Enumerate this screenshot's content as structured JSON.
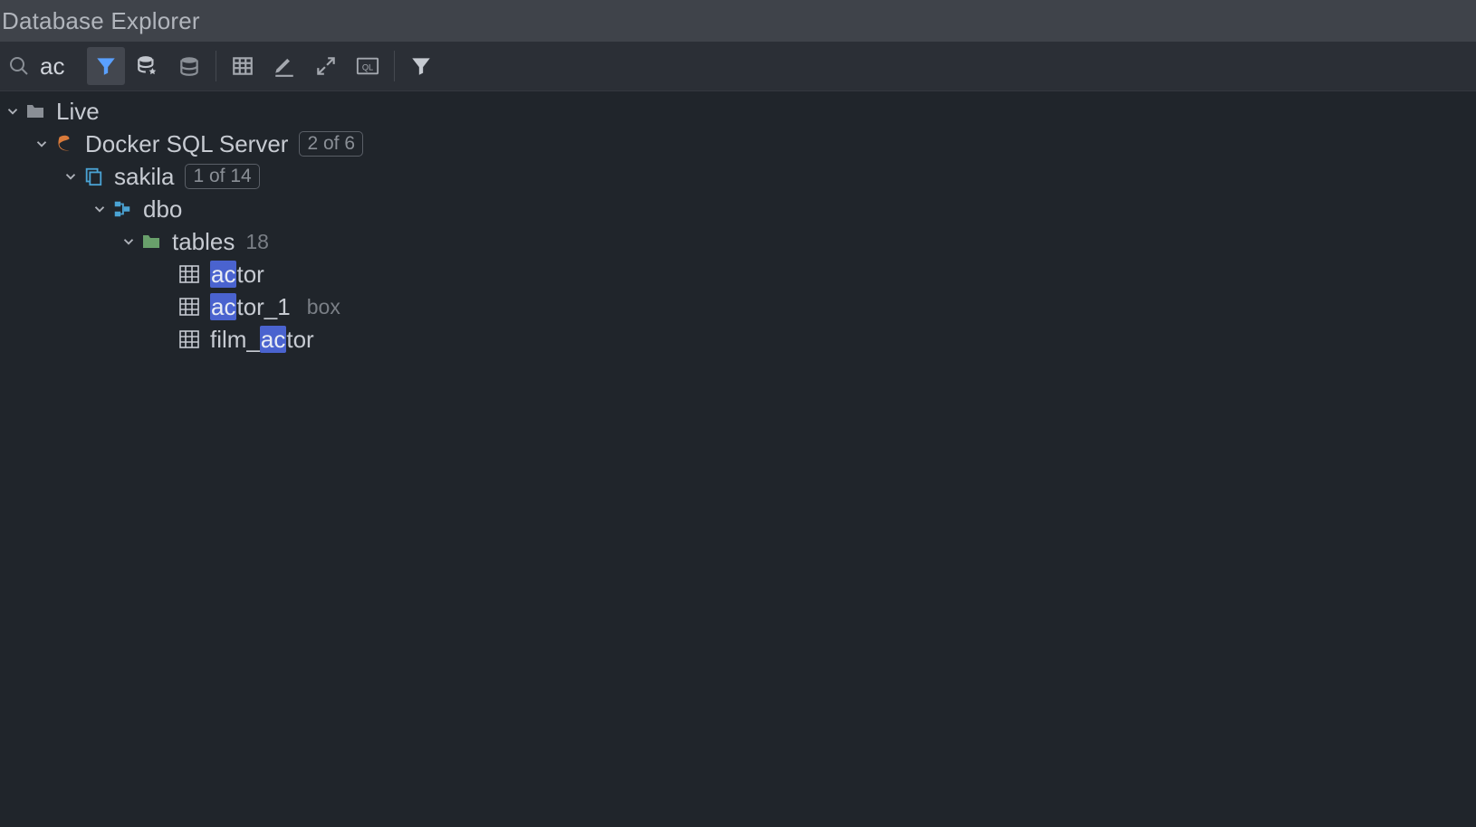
{
  "title": "Database Explorer",
  "search": {
    "value": "ac"
  },
  "toolbar": {
    "filter_active": true
  },
  "tree": {
    "root": {
      "label": "Live",
      "expanded": true,
      "children": [
        {
          "label": "Docker SQL Server",
          "badge": "2 of 6",
          "expanded": true,
          "children": [
            {
              "label": "sakila",
              "badge": "1 of 14",
              "expanded": true,
              "children": [
                {
                  "label": "dbo",
                  "expanded": true,
                  "children": [
                    {
                      "label": "tables",
                      "count": "18",
                      "expanded": true,
                      "children": [
                        {
                          "label": "actor",
                          "match_prefix": "",
                          "match": "ac",
                          "match_suffix": "tor",
                          "secondary": ""
                        },
                        {
                          "label": "actor_1",
                          "match_prefix": "",
                          "match": "ac",
                          "match_suffix": "tor_1",
                          "secondary": "box"
                        },
                        {
                          "label": "film_actor",
                          "match_prefix": "film_",
                          "match": "ac",
                          "match_suffix": "tor",
                          "secondary": ""
                        }
                      ]
                    }
                  ]
                }
              ]
            }
          ]
        }
      ]
    }
  }
}
